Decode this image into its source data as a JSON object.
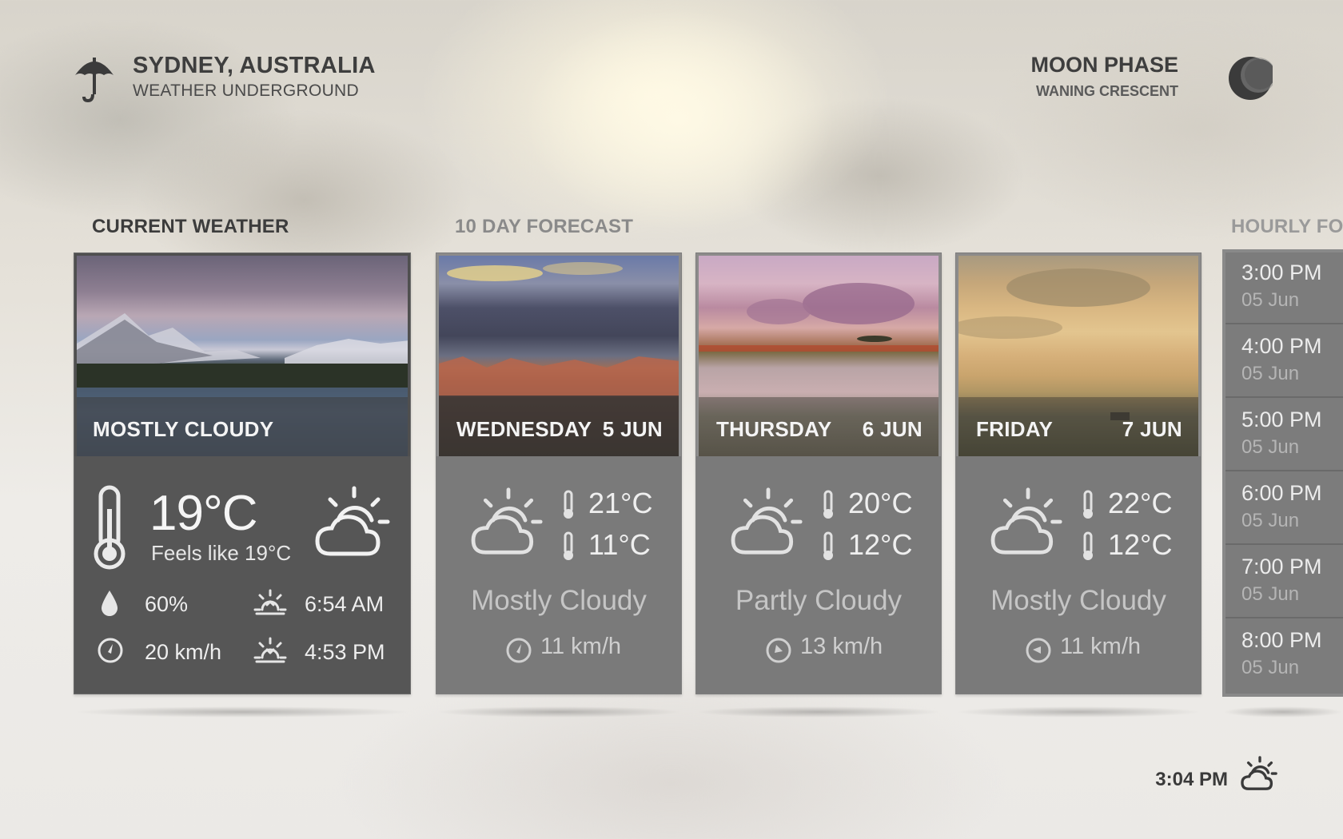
{
  "header": {
    "location": "SYDNEY, AUSTRALIA",
    "provider": "WEATHER UNDERGROUND",
    "location_icon": "umbrella-icon",
    "moon_title": "MOON PHASE",
    "moon_phase": "WANING CRESCENT",
    "moon_icon": "crescent-moon-icon"
  },
  "sections": {
    "current": "CURRENT WEATHER",
    "forecast": "10 DAY FORECAST",
    "hourly": "HOURLY FORECAST"
  },
  "current": {
    "condition": "MOSTLY CLOUDY",
    "temperature": "19°C",
    "feels_like": "Feels like 19°C",
    "humidity": "60%",
    "wind": "20 km/h",
    "sunrise": "6:54 AM",
    "sunset": "4:53 PM",
    "icon": "partly-cloudy-day-icon"
  },
  "forecast": [
    {
      "day": "WEDNESDAY",
      "date": "5 JUN",
      "high": "21°C",
      "low": "11°C",
      "condition": "Mostly Cloudy",
      "wind": "11 km/h"
    },
    {
      "day": "THURSDAY",
      "date": "6 JUN",
      "high": "20°C",
      "low": "12°C",
      "condition": "Partly Cloudy",
      "wind": "13 km/h"
    },
    {
      "day": "FRIDAY",
      "date": "7 JUN",
      "high": "22°C",
      "low": "12°C",
      "condition": "Mostly Cloudy",
      "wind": "11 km/h"
    }
  ],
  "hourly": [
    {
      "time": "3:00 PM",
      "date": "05 Jun"
    },
    {
      "time": "4:00 PM",
      "date": "05 Jun"
    },
    {
      "time": "5:00 PM",
      "date": "05 Jun"
    },
    {
      "time": "6:00 PM",
      "date": "05 Jun"
    },
    {
      "time": "7:00 PM",
      "date": "05 Jun"
    },
    {
      "time": "8:00 PM",
      "date": "05 Jun"
    }
  ],
  "footer": {
    "time": "3:04 PM",
    "icon": "partly-cloudy-day-icon"
  },
  "colors": {
    "card_dark": "#565656",
    "card_light": "#787878",
    "header_text": "#3e3e3e"
  }
}
